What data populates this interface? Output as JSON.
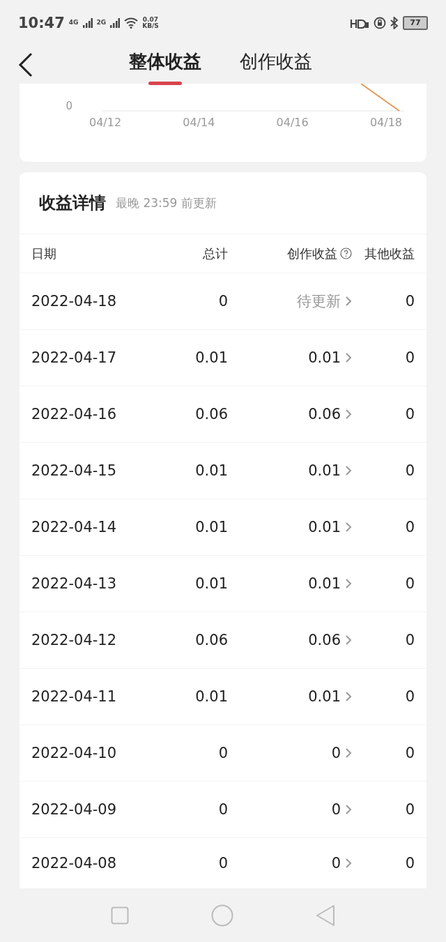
{
  "status_bar": {
    "time": "10:47",
    "sim_1": "4G",
    "sim_2": "2G",
    "speed": "0.07",
    "speed_unit": "KB/S",
    "battery": "77"
  },
  "header": {
    "tabs": [
      {
        "label": "整体收益",
        "selected": true
      },
      {
        "label": "创作收益",
        "selected": false
      }
    ]
  },
  "chart": {
    "y_tick": "0",
    "x_labels": [
      "04/12",
      "04/14",
      "04/16",
      "04/18"
    ]
  },
  "details": {
    "title": "收益详情",
    "note": "最晚 23:59 前更新",
    "columns": [
      "日期",
      "总计",
      "创作收益",
      "其他收益"
    ],
    "rows": [
      {
        "date": "2022-04-18",
        "total": "0",
        "creation": "待更新",
        "pending": true,
        "other": "0"
      },
      {
        "date": "2022-04-17",
        "total": "0.01",
        "creation": "0.01",
        "pending": false,
        "other": "0"
      },
      {
        "date": "2022-04-16",
        "total": "0.06",
        "creation": "0.06",
        "pending": false,
        "other": "0"
      },
      {
        "date": "2022-04-15",
        "total": "0.01",
        "creation": "0.01",
        "pending": false,
        "other": "0"
      },
      {
        "date": "2022-04-14",
        "total": "0.01",
        "creation": "0.01",
        "pending": false,
        "other": "0"
      },
      {
        "date": "2022-04-13",
        "total": "0.01",
        "creation": "0.01",
        "pending": false,
        "other": "0"
      },
      {
        "date": "2022-04-12",
        "total": "0.06",
        "creation": "0.06",
        "pending": false,
        "other": "0"
      },
      {
        "date": "2022-04-11",
        "total": "0.01",
        "creation": "0.01",
        "pending": false,
        "other": "0"
      },
      {
        "date": "2022-04-10",
        "total": "0",
        "creation": "0",
        "pending": false,
        "other": "0"
      },
      {
        "date": "2022-04-09",
        "total": "0",
        "creation": "0",
        "pending": false,
        "other": "0"
      },
      {
        "date": "2022-04-08",
        "total": "0",
        "creation": "0",
        "pending": false,
        "other": "0"
      }
    ]
  }
}
